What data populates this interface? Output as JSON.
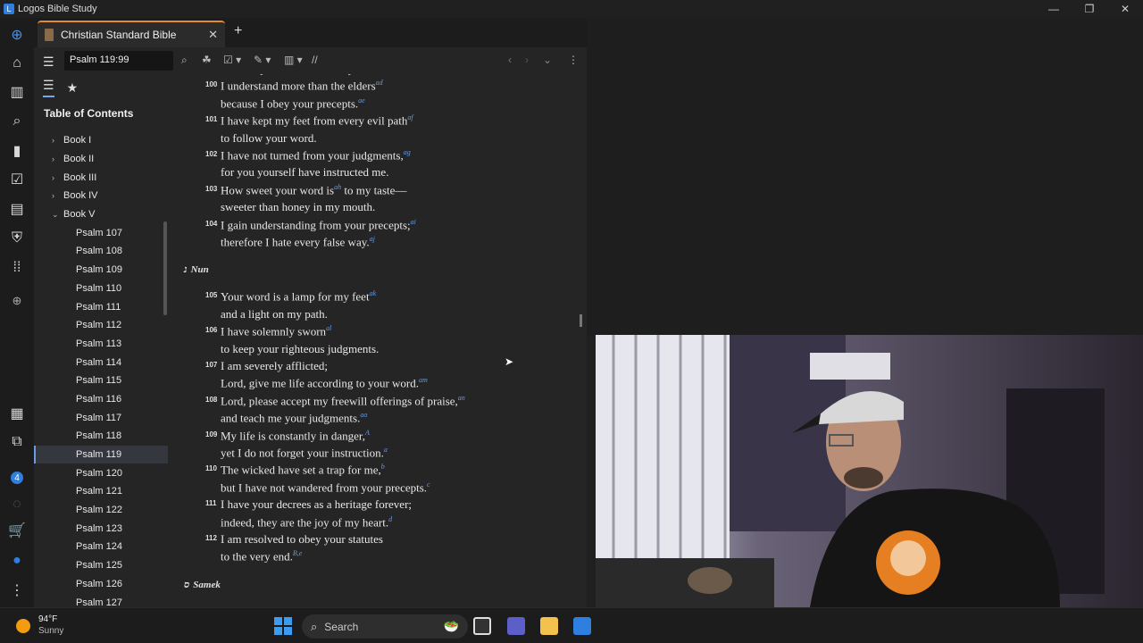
{
  "window": {
    "title": "Logos Bible Study"
  },
  "tabs": [
    {
      "label": "Christian Standard Bible"
    }
  ],
  "toolbar": {
    "reference": "Psalm 119:99"
  },
  "sidebar": {
    "title": "Table of Contents",
    "books": [
      "Book I",
      "Book II",
      "Book III",
      "Book IV",
      "Book V"
    ],
    "psalms": [
      "Psalm 107",
      "Psalm 108",
      "Psalm 109",
      "Psalm 110",
      "Psalm 111",
      "Psalm 112",
      "Psalm 113",
      "Psalm 114",
      "Psalm 115",
      "Psalm 116",
      "Psalm 117",
      "Psalm 118",
      "Psalm 119",
      "Psalm 120",
      "Psalm 121",
      "Psalm 122",
      "Psalm 123",
      "Psalm 124",
      "Psalm 125",
      "Psalm 126",
      "Psalm 127"
    ],
    "selected": "Psalm 119"
  },
  "content": {
    "lines": [
      {
        "num": "",
        "text": "because your decrees are my meditation.",
        "fn": "ac"
      },
      {
        "num": "100",
        "text": "I understand more than the elders",
        "fn": "ad"
      },
      {
        "num": "",
        "text": "because I obey your precepts.",
        "fn": "ae"
      },
      {
        "num": "101",
        "text": "I have kept my feet from every evil path",
        "fn": "af"
      },
      {
        "num": "",
        "text": "to follow your word.",
        "fn": ""
      },
      {
        "num": "102",
        "text": "I have not turned from your judgments,",
        "fn": "ag"
      },
      {
        "num": "",
        "text": "for you yourself have instructed me.",
        "fn": ""
      },
      {
        "num": "103",
        "text": "How sweet your word is",
        "fn": "ah",
        "after": " to my taste—"
      },
      {
        "num": "",
        "text": "sweeter than honey in my mouth.",
        "fn": ""
      },
      {
        "num": "104",
        "text": "I gain understanding from your precepts;",
        "fn": "ai"
      },
      {
        "num": "",
        "text": "therefore I hate every false way.",
        "fn": "aj"
      },
      {
        "num": "105",
        "text": "Your word is a lamp for my feet",
        "fn": "ak"
      },
      {
        "num": "",
        "text": "and a light on my path.",
        "fn": ""
      },
      {
        "num": "106",
        "text": "I have solemnly sworn",
        "fn": "al"
      },
      {
        "num": "",
        "text": "to keep your righteous judgments.",
        "fn": ""
      },
      {
        "num": "107",
        "text": "I am severely afflicted;",
        "fn": ""
      },
      {
        "num": "",
        "text": "Lord, give me life according to your word.",
        "fn": "am"
      },
      {
        "num": "108",
        "text": "Lord, please accept my freewill offerings of praise,",
        "fn": "an"
      },
      {
        "num": "",
        "text": "and teach me your judgments.",
        "fn": "ao"
      },
      {
        "num": "109",
        "text": "My life is constantly in danger,",
        "fn": "A"
      },
      {
        "num": "",
        "text": "yet I do not forget your instruction.",
        "fn": "a"
      },
      {
        "num": "110",
        "text": "The wicked have set a trap for me,",
        "fn": "b"
      },
      {
        "num": "",
        "text": "but I have not wandered from your precepts.",
        "fn": "c"
      },
      {
        "num": "111",
        "text": "I have your decrees as a heritage forever;",
        "fn": ""
      },
      {
        "num": "",
        "text": "indeed, they are the joy of my heart.",
        "fn": "d"
      },
      {
        "num": "112",
        "text": "I am resolved to obey your statutes",
        "fn": ""
      },
      {
        "num": "",
        "text": "to the very end.",
        "fn": "B,e"
      }
    ],
    "headings": [
      {
        "letter": "נ",
        "name": "Nun"
      },
      {
        "letter": "ס",
        "name": "Samek"
      }
    ]
  },
  "taskbar": {
    "weather_temp": "94°F",
    "weather_desc": "Sunny",
    "search_placeholder": "Search"
  },
  "colors": {
    "accent": "#e48a2c",
    "footnote": "#6b9be0",
    "selection": "#34383e"
  }
}
